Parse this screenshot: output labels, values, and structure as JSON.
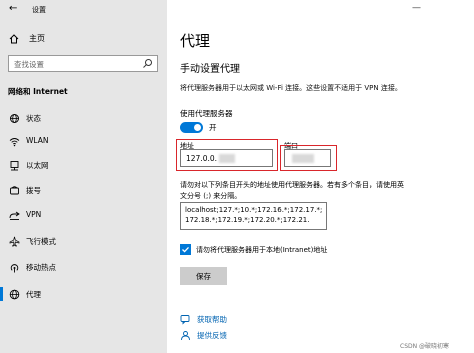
{
  "window": {
    "title": "设置",
    "minimize": "—"
  },
  "sidebar": {
    "home": "主页",
    "search_placeholder": "查找设置",
    "section": "网络和 Internet",
    "items": [
      {
        "label": "状态",
        "icon": "status-icon"
      },
      {
        "label": "WLAN",
        "icon": "wifi-icon"
      },
      {
        "label": "以太网",
        "icon": "ethernet-icon"
      },
      {
        "label": "拨号",
        "icon": "dialup-icon"
      },
      {
        "label": "VPN",
        "icon": "vpn-icon"
      },
      {
        "label": "飞行模式",
        "icon": "airplane-icon"
      },
      {
        "label": "移动热点",
        "icon": "hotspot-icon"
      },
      {
        "label": "代理",
        "icon": "proxy-icon",
        "selected": true
      }
    ]
  },
  "main": {
    "title": "代理",
    "section": "手动设置代理",
    "description": "将代理服务器用于以太网或 Wi-Fi 连接。这些设置不适用于 VPN 连接。",
    "toggle_label": "使用代理服务器",
    "toggle_state": "开",
    "address_label": "地址",
    "address_value": "127.0.0.",
    "port_label": "端口",
    "exceptions_desc": "请勿对以下列条目开头的地址使用代理服务器。若有多个条目，请使用英文分号 (;) 来分隔。",
    "exceptions_value": "localhost;127.*;10.*;172.16.*;172.17.*;172.18.*;172.19.*;172.20.*;172.21.",
    "local_checkbox_label": "请勿将代理服务器用于本地(Intranet)地址",
    "save_label": "保存",
    "help_link": "获取帮助",
    "feedback_link": "提供反馈"
  },
  "watermark": "CSDN @破晓初寒",
  "colors": {
    "accent": "#0078d7",
    "highlight": "#d9262b",
    "link": "#0063b1"
  }
}
